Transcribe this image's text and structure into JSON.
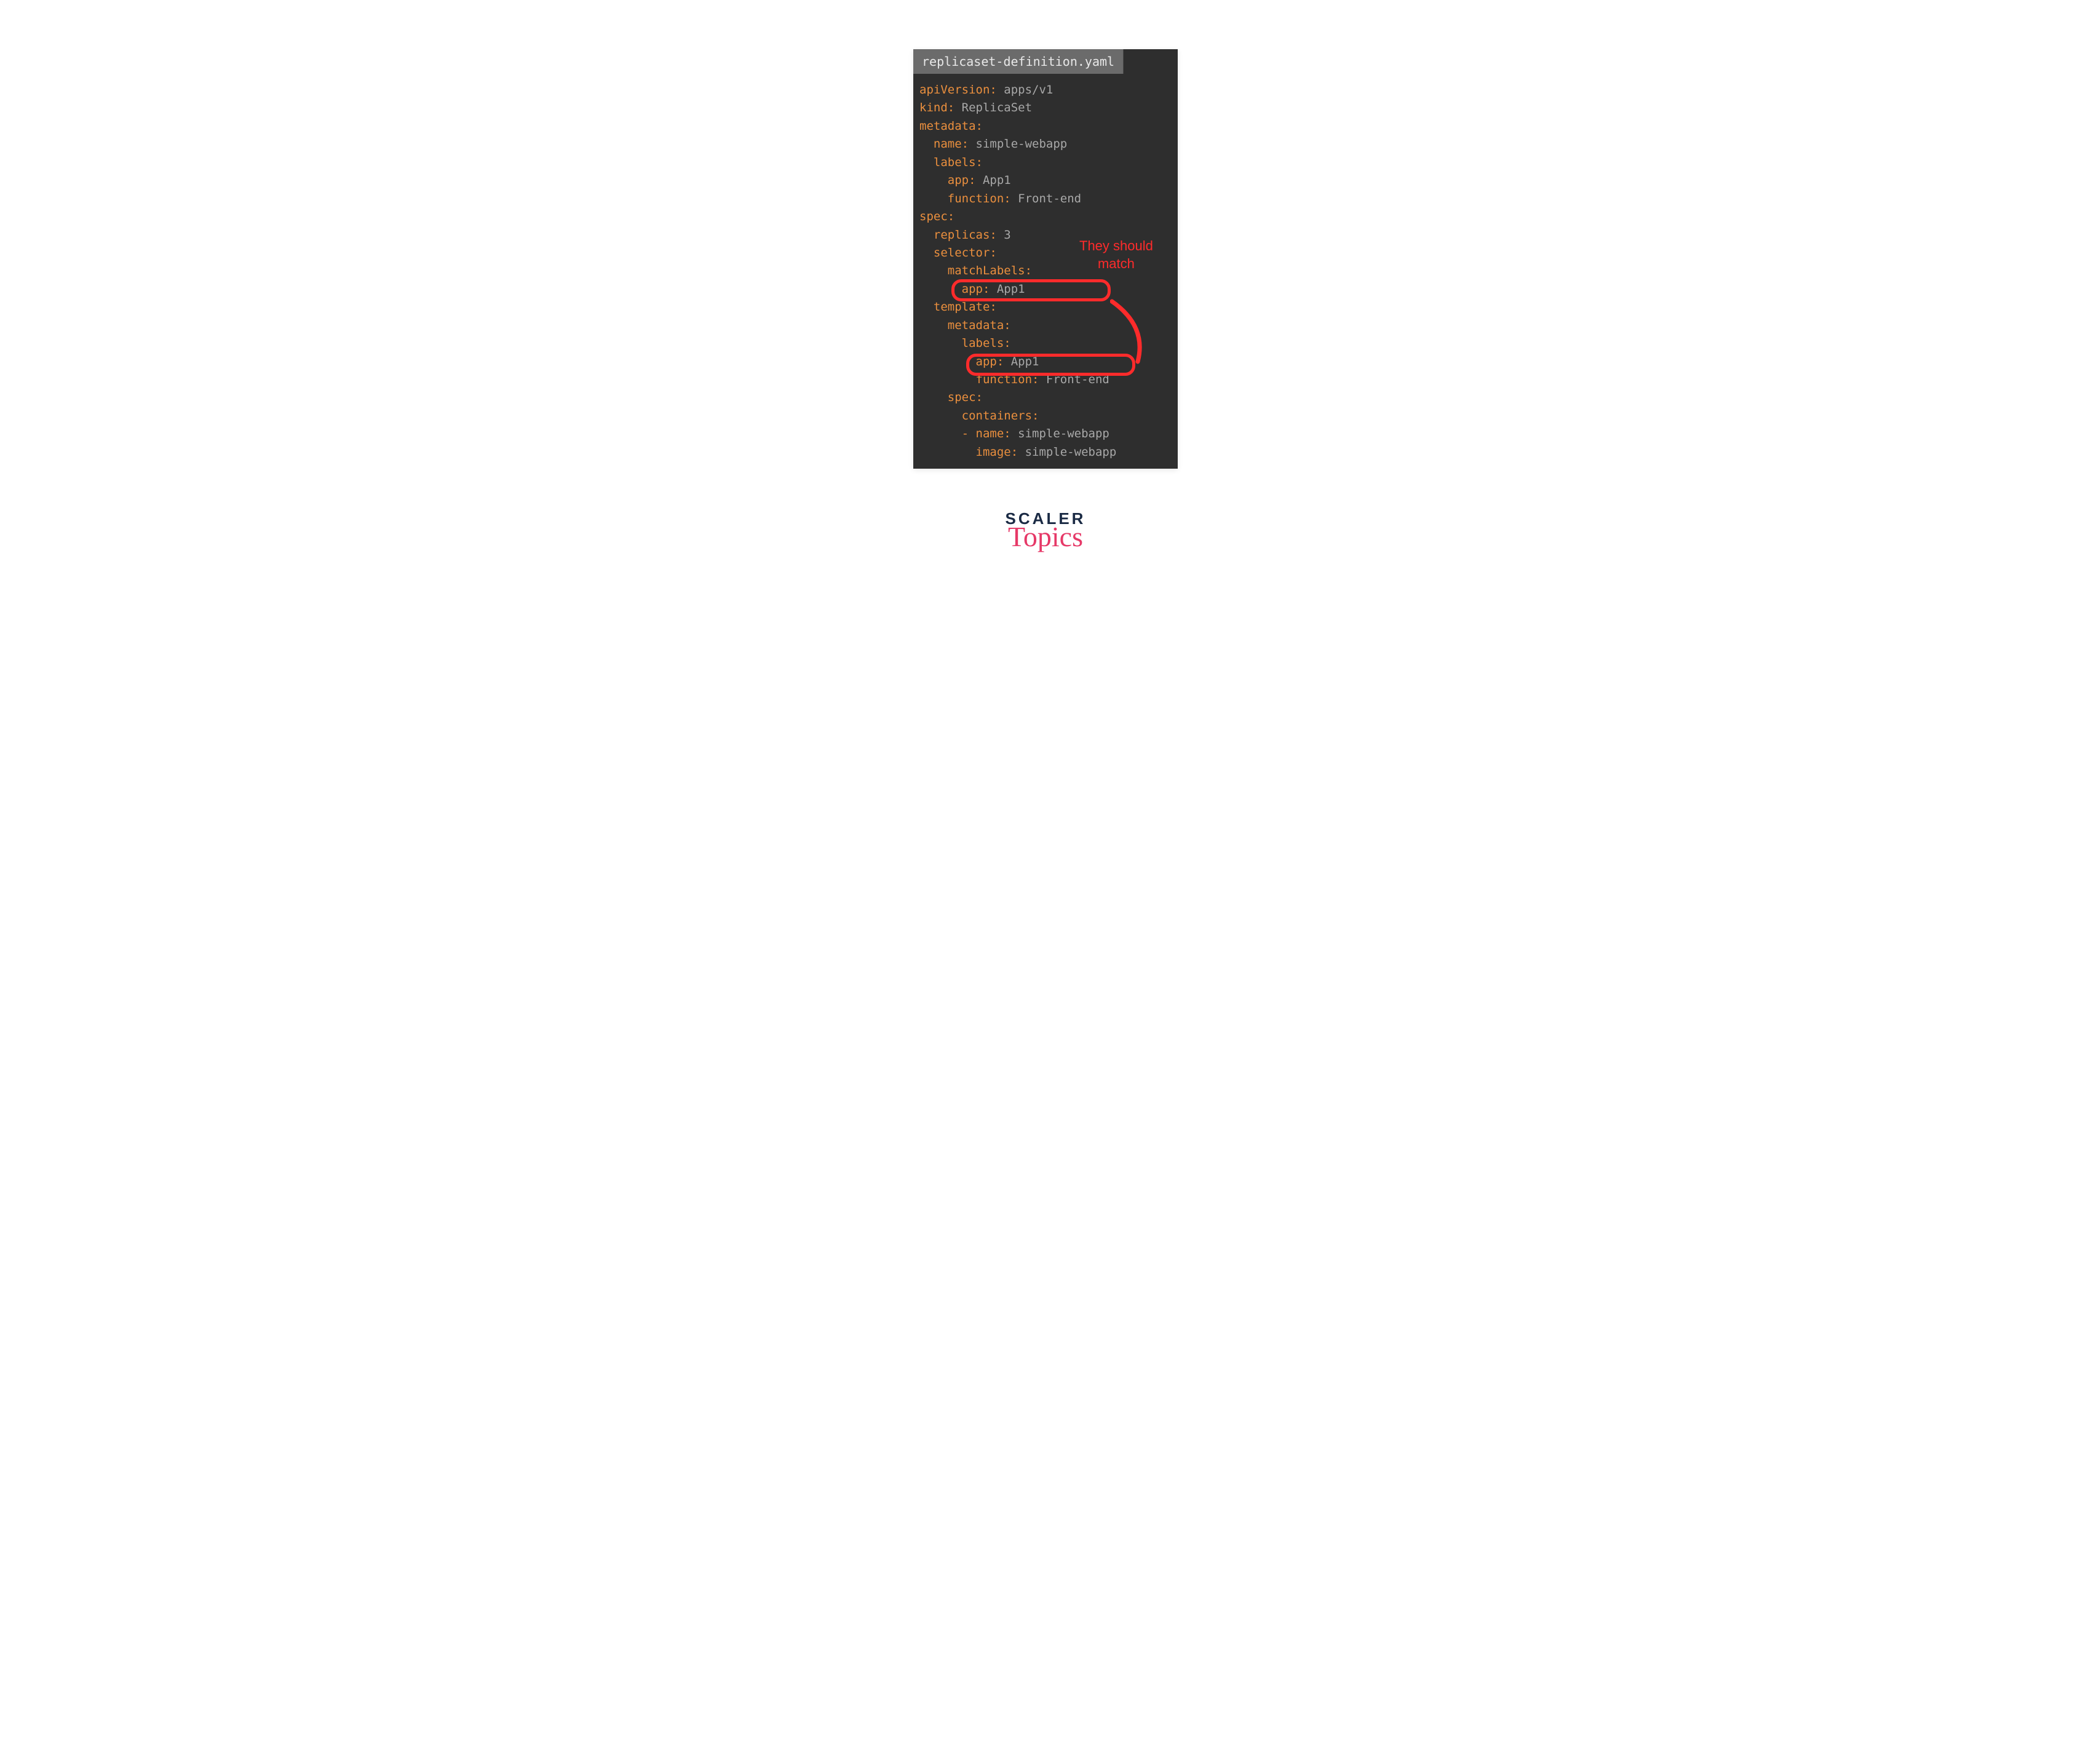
{
  "editor": {
    "filename": "replicaset-definition.yaml"
  },
  "code": {
    "l01_key": "apiVersion:",
    "l01_val": " apps/v1",
    "l02_key": "kind:",
    "l02_val": " ReplicaSet",
    "l03_key": "metadata:",
    "l04_key": "  name:",
    "l04_val": " simple-webapp",
    "l05_key": "  labels:",
    "l06_key": "    app:",
    "l06_val": " App1",
    "l07_key": "    function:",
    "l07_val": " Front-end",
    "l08_key": "spec:",
    "l09_key": "  replicas:",
    "l09_val": " 3",
    "l10_key": "  selector:",
    "l11_key": "    matchLabels:",
    "l12_key": "      app:",
    "l12_val": " App1",
    "l13_key": "  template:",
    "l14_key": "    metadata:",
    "l15_key": "      labels:",
    "l16_key": "        app:",
    "l16_val": " App1",
    "l17_key": "        function:",
    "l17_val": " Front-end",
    "l18_key": "    spec:",
    "l19_key": "      containers:",
    "l20_key": "      - name:",
    "l20_val": " simple-webapp",
    "l21_key": "        image:",
    "l21_val": " simple-webapp"
  },
  "annotation": {
    "text1": "They should",
    "text2": "match"
  },
  "logo": {
    "top": "SCALER",
    "bottom": "Topics"
  }
}
